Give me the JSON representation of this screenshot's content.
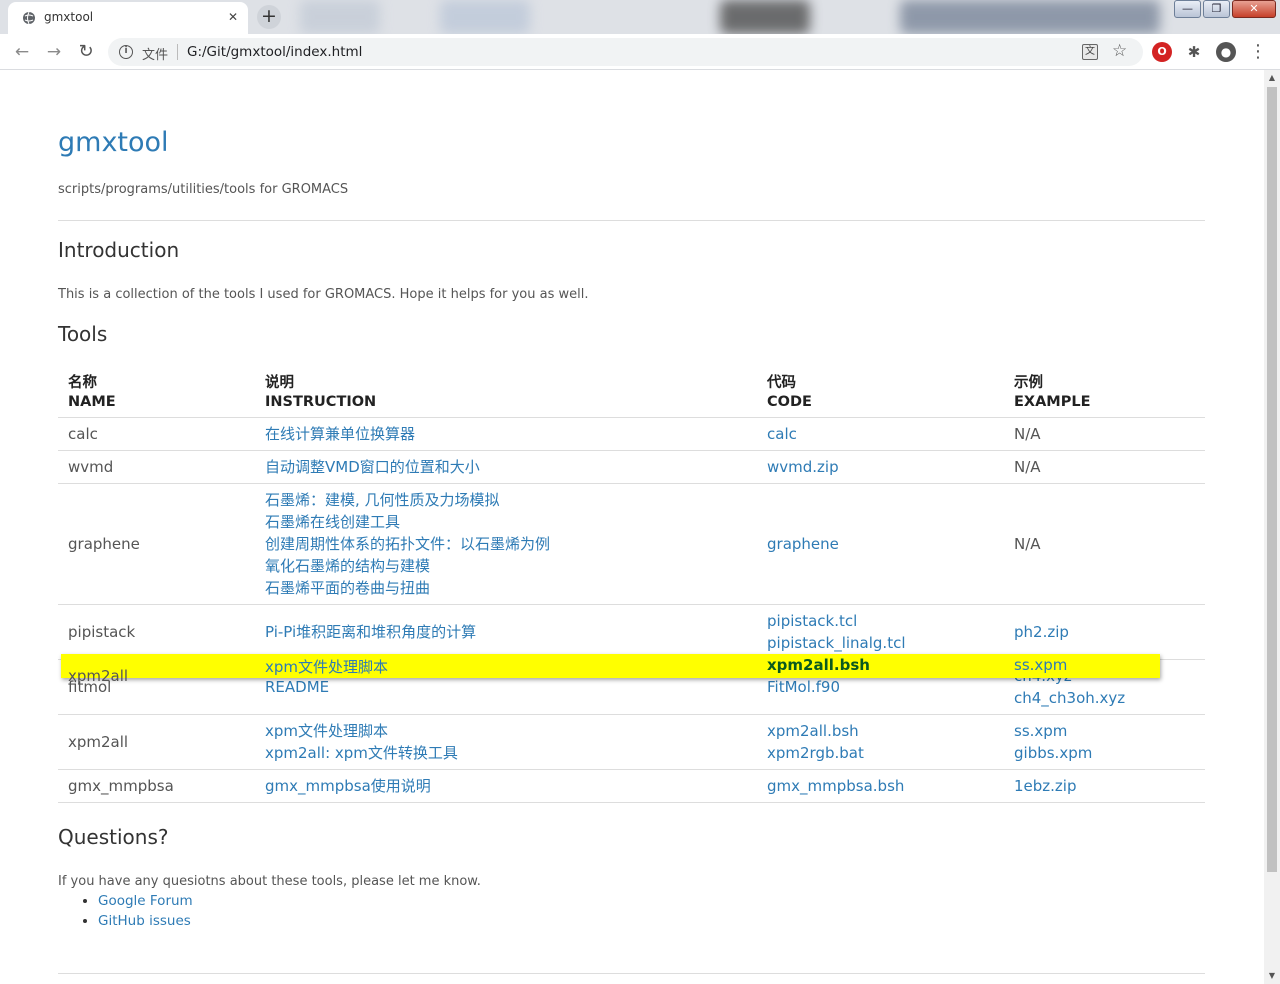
{
  "browser": {
    "tab_title": "gmxtool",
    "tab_close": "✕",
    "new_tab": "+",
    "scheme_label": "文件",
    "url": "G:/Git/gmxtool/index.html",
    "back": "←",
    "forward": "→",
    "reload": "↻",
    "star": "☆",
    "ext_red": "O",
    "ext_puzzle": "✱",
    "ext_avatar": "●",
    "ext_menu": "⋮",
    "translate": "文",
    "window_minimize": "—",
    "window_restore": "❐",
    "window_close": "✕",
    "icons": [
      "globe-icon",
      "info-icon",
      "translate-icon",
      "star-icon",
      "opera-icon",
      "puzzle-icon",
      "avatar-icon",
      "menu-icon"
    ]
  },
  "page": {
    "title": "gmxtool",
    "tagline": "scripts/programs/utilities/tools for GROMACS",
    "intro_heading": "Introduction",
    "intro_text": "This is a collection of the tools I used for GROMACS. Hope it helps for you as well.",
    "tools_heading": "Tools",
    "table": {
      "headers": [
        {
          "zh": "名称",
          "en": "NAME"
        },
        {
          "zh": "说明",
          "en": "INSTRUCTION"
        },
        {
          "zh": "代码",
          "en": "CODE"
        },
        {
          "zh": "示例",
          "en": "EXAMPLE"
        }
      ],
      "rows": [
        {
          "name": "calc",
          "instruction": [
            "在线计算兼单位换算器"
          ],
          "code": [
            "calc"
          ],
          "example": [
            "N/A"
          ]
        },
        {
          "name": "wvmd",
          "instruction": [
            "自动调整VMD窗口的位置和大小"
          ],
          "code": [
            "wvmd.zip"
          ],
          "example": [
            "N/A"
          ]
        },
        {
          "name": "graphene",
          "instruction": [
            "石墨烯：建模, 几何性质及力场模拟",
            "石墨烯在线创建工具",
            "创建周期性体系的拓扑文件：以石墨烯为例",
            "氧化石墨烯的结构与建模",
            "石墨烯平面的卷曲与扭曲"
          ],
          "code": [
            "graphene"
          ],
          "example": [
            "N/A"
          ]
        },
        {
          "name": "pipistack",
          "instruction": [
            "Pi-Pi堆积距离和堆积角度的计算"
          ],
          "code": [
            "pipistack.tcl",
            "pipistack_linalg.tcl"
          ],
          "example": [
            "ph2.zip"
          ]
        },
        {
          "name": "fitmol",
          "instruction": [
            "README"
          ],
          "code": [
            "FitMol.f90"
          ],
          "example": [
            "ch4.xyz",
            "ch4_ch3oh.xyz"
          ]
        },
        {
          "name": "xpm2all",
          "instruction": [
            "xpm文件处理脚本",
            "xpm2all: xpm文件转换工具"
          ],
          "code": [
            "xpm2all.bsh",
            "xpm2rgb.bat"
          ],
          "example": [
            "ss.xpm",
            "gibbs.xpm"
          ]
        },
        {
          "name": "gmx_mmpbsa",
          "instruction": [
            "gmx_mmpbsa使用说明"
          ],
          "code": [
            "gmx_mmpbsa.bsh"
          ],
          "example": [
            "1ebz.zip"
          ]
        }
      ]
    },
    "questions_heading": "Questions?",
    "questions_text": "If you have any quesiotns about these tools, please let me know.",
    "question_links": [
      "Google Forum",
      "GitHub issues"
    ]
  }
}
